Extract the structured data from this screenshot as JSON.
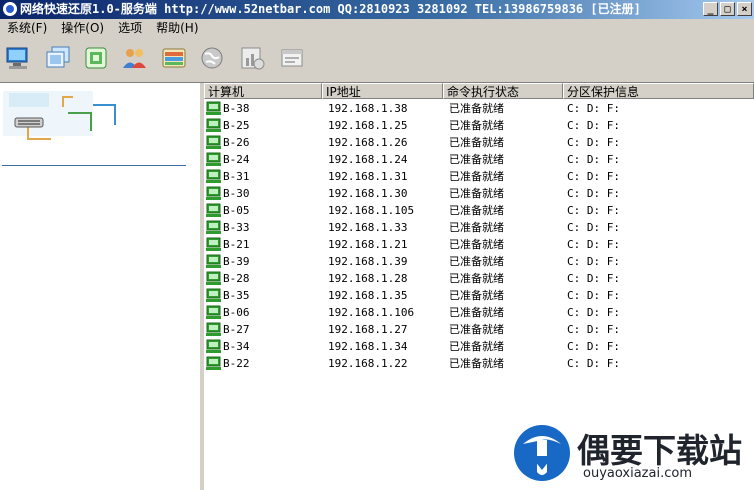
{
  "window": {
    "title": "网络快速还原1.0-服务端 http://www.52netbar.com QQ:2810923 3281092 TEL:13986759836 [已注册]",
    "buttons": [
      "_",
      "□",
      "×"
    ]
  },
  "menu": [
    "系统(F)",
    "操作(O)",
    "选项",
    "帮助(H)"
  ],
  "toolbar": {
    "icons": [
      "computer-icon",
      "screens-icon",
      "grid-icon",
      "users-icon",
      "layers-icon",
      "globe-icon",
      "chart-icon",
      "window-icon"
    ]
  },
  "table": {
    "headers": [
      "计算机",
      "IP地址",
      "命令执行状态",
      "分区保护信息"
    ],
    "rows": [
      {
        "name": "B-38",
        "ip": "192.168.1.38",
        "status": "已准备就绪",
        "protect": "C: D: F:"
      },
      {
        "name": "B-25",
        "ip": "192.168.1.25",
        "status": "已准备就绪",
        "protect": "C: D: F:"
      },
      {
        "name": "B-26",
        "ip": "192.168.1.26",
        "status": "已准备就绪",
        "protect": "C: D: F:"
      },
      {
        "name": "B-24",
        "ip": "192.168.1.24",
        "status": "已准备就绪",
        "protect": "C: D: F:"
      },
      {
        "name": "B-31",
        "ip": "192.168.1.31",
        "status": "已准备就绪",
        "protect": "C: D: F:"
      },
      {
        "name": "B-30",
        "ip": "192.168.1.30",
        "status": "已准备就绪",
        "protect": "C: D: F:"
      },
      {
        "name": "B-05",
        "ip": "192.168.1.105",
        "status": "已准备就绪",
        "protect": "C: D: F:"
      },
      {
        "name": "B-33",
        "ip": "192.168.1.33",
        "status": "已准备就绪",
        "protect": "C: D: F:"
      },
      {
        "name": "B-21",
        "ip": "192.168.1.21",
        "status": "已准备就绪",
        "protect": "C: D: F:"
      },
      {
        "name": "B-39",
        "ip": "192.168.1.39",
        "status": "已准备就绪",
        "protect": "C: D: F:"
      },
      {
        "name": "B-28",
        "ip": "192.168.1.28",
        "status": "已准备就绪",
        "protect": "C: D: F:"
      },
      {
        "name": "B-35",
        "ip": "192.168.1.35",
        "status": "已准备就绪",
        "protect": "C: D: F:"
      },
      {
        "name": "B-06",
        "ip": "192.168.1.106",
        "status": "已准备就绪",
        "protect": "C: D: F:"
      },
      {
        "name": "B-27",
        "ip": "192.168.1.27",
        "status": "已准备就绪",
        "protect": "C: D: F:"
      },
      {
        "name": "B-34",
        "ip": "192.168.1.34",
        "status": "已准备就绪",
        "protect": "C: D: F:"
      },
      {
        "name": "B-22",
        "ip": "192.168.1.22",
        "status": "已准备就绪",
        "protect": "C: D: F:"
      }
    ]
  },
  "watermark": {
    "brand": "偶要下载站",
    "url": "ouyaoxiazai.com"
  },
  "colors": {
    "title_bar": "#0a246a",
    "pc_icon": "#2e9b2e",
    "panel_bg": "#d4d0c8"
  }
}
